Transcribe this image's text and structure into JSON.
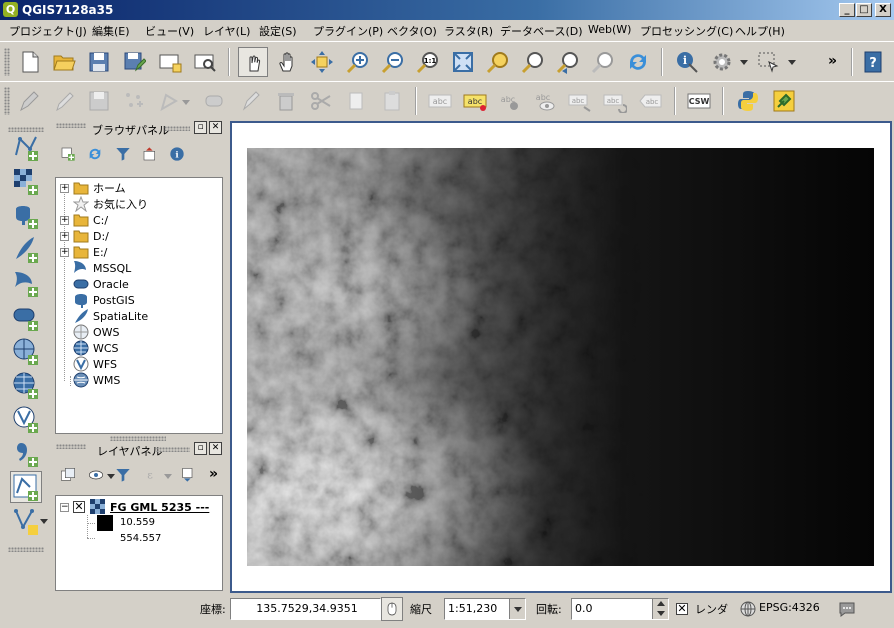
{
  "window": {
    "title": "QGIS7128a35",
    "logo": "Q",
    "minimize": "_",
    "maximize": "□",
    "close": "X"
  },
  "menu": [
    {
      "label": "プロジェクト(J)"
    },
    {
      "label": "編集(E)"
    },
    {
      "label": "ビュー(V)"
    },
    {
      "label": "レイヤ(L)"
    },
    {
      "label": "設定(S)"
    },
    {
      "label": "プラグイン(P)"
    },
    {
      "label": "ベクタ(O)"
    },
    {
      "label": "ラスタ(R)"
    },
    {
      "label": "データベース(D)"
    },
    {
      "label": "Web(W)"
    },
    {
      "label": "プロセッシング(C)"
    },
    {
      "label": "ヘルプ(H)"
    }
  ],
  "toolbar": {
    "more": "»",
    "label_icons": [
      "abc",
      "abc",
      "abc",
      "abc",
      "abc",
      "abc",
      "abc"
    ],
    "csw_label": "CSW"
  },
  "browser_panel": {
    "title": "ブラウザパネル",
    "items": [
      {
        "label": "ホーム",
        "icon": "folder-icon",
        "expandable": true
      },
      {
        "label": "お気に入り",
        "icon": "star-icon",
        "expandable": false
      },
      {
        "label": "C:/",
        "icon": "folder-icon",
        "expandable": true
      },
      {
        "label": "D:/",
        "icon": "folder-icon",
        "expandable": true
      },
      {
        "label": "E:/",
        "icon": "folder-icon",
        "expandable": true
      },
      {
        "label": "MSSQL",
        "icon": "mssql-icon",
        "expandable": false
      },
      {
        "label": "Oracle",
        "icon": "oracle-icon",
        "expandable": false
      },
      {
        "label": "PostGIS",
        "icon": "postgis-icon",
        "expandable": false
      },
      {
        "label": "SpatiaLite",
        "icon": "spatialite-icon",
        "expandable": false
      },
      {
        "label": "OWS",
        "icon": "ows-icon",
        "expandable": false
      },
      {
        "label": "WCS",
        "icon": "wcs-icon",
        "expandable": false
      },
      {
        "label": "WFS",
        "icon": "wfs-icon",
        "expandable": false
      },
      {
        "label": "WMS",
        "icon": "wms-icon",
        "expandable": false
      }
    ]
  },
  "layers_panel": {
    "title": "レイヤパネル",
    "layer": {
      "name": "FG GML 5235 ---",
      "checked": true,
      "legend_max": "10.559",
      "legend_min": "554.557"
    }
  },
  "status": {
    "coord_label": "座標:",
    "coord_value": "135.7529,34.9351",
    "scale_label": "縮尺",
    "scale_value": "1:51,230",
    "rotation_label": "回転:",
    "rotation_value": "0.0",
    "render_label": "レンダ",
    "render_checked": true,
    "crs": "EPSG:4326"
  },
  "colors": {
    "titlebar_start": "#0a246a",
    "map_border": "#3c5a8c",
    "qgis_green": "#93b023"
  }
}
